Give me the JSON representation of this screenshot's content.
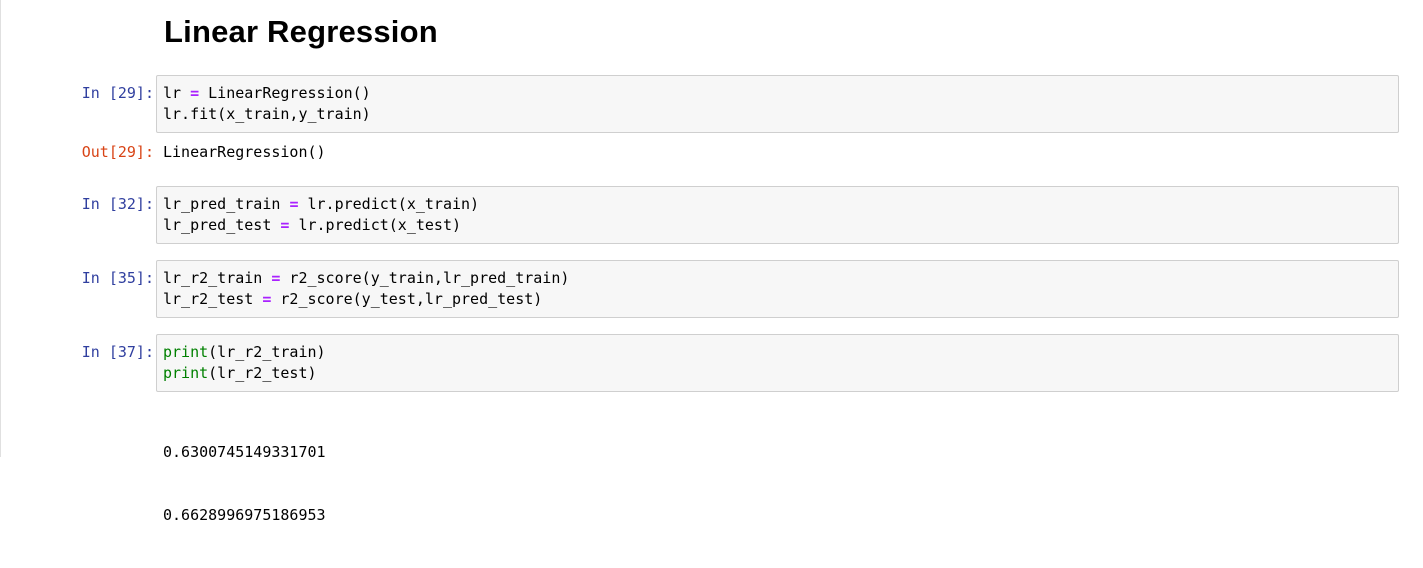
{
  "heading": "Linear Regression",
  "colors": {
    "in_prompt": "#303f9f",
    "out_prompt": "#d84315",
    "operator": "#aa22ff",
    "builtin": "#008000",
    "cell_background": "#f7f7f7",
    "cell_border": "#cfcfcf"
  },
  "cells": [
    {
      "in_prompt": "In [29]:",
      "lines": [
        {
          "pre": "lr ",
          "op": "=",
          "post": " LinearRegression()"
        },
        {
          "text": "lr.fit(x_train,y_train)"
        }
      ],
      "out_prompt": "Out[29]:",
      "output": "LinearRegression()"
    },
    {
      "in_prompt": "In [32]:",
      "lines": [
        {
          "pre": "lr_pred_train ",
          "op": "=",
          "post": " lr.predict(x_train)"
        },
        {
          "pre": "lr_pred_test ",
          "op": "=",
          "post": " lr.predict(x_test)"
        }
      ]
    },
    {
      "in_prompt": "In [35]:",
      "lines": [
        {
          "pre": "lr_r2_train ",
          "op": "=",
          "post": " r2_score(y_train,lr_pred_train)"
        },
        {
          "pre": "lr_r2_test ",
          "op": "=",
          "post": " r2_score(y_test,lr_pred_test)"
        }
      ]
    },
    {
      "in_prompt": "In [37]:",
      "lines": [
        {
          "fn": "print",
          "post": "(lr_r2_train)"
        },
        {
          "fn": "print",
          "post": "(lr_r2_test)"
        }
      ],
      "stdout": [
        "0.6300745149331701",
        "0.6628996975186953"
      ]
    }
  ]
}
